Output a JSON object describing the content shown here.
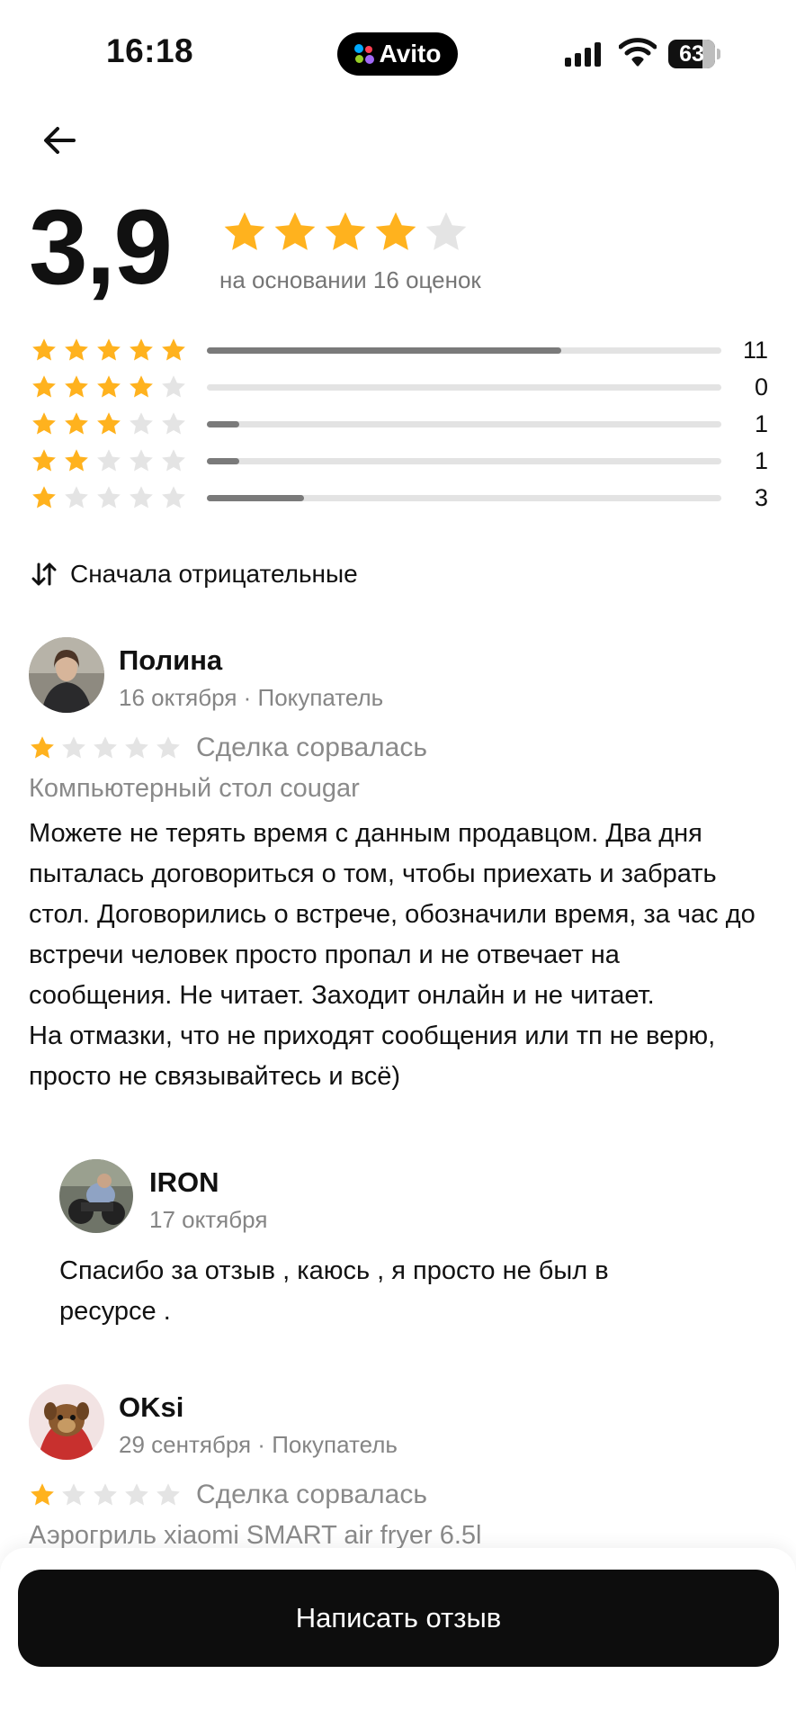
{
  "status_bar": {
    "time": "16:18",
    "app_badge": "Avito",
    "battery": "63"
  },
  "summary": {
    "rating": "3,9",
    "rating_stars": 4,
    "based_on": "на основании 16 оценок",
    "distribution": [
      {
        "stars": 5,
        "count": "11",
        "fraction": 0.688
      },
      {
        "stars": 4,
        "count": "0",
        "fraction": 0.0
      },
      {
        "stars": 3,
        "count": "1",
        "fraction": 0.063
      },
      {
        "stars": 2,
        "count": "1",
        "fraction": 0.063
      },
      {
        "stars": 1,
        "count": "3",
        "fraction": 0.188
      }
    ]
  },
  "sort": {
    "label": "Сначала отрицательные"
  },
  "reviews": [
    {
      "name": "Полина",
      "meta": "16 октября · Покупатель",
      "stars": 1,
      "status": "Сделка сорвалась",
      "item": "Компьютерный стол cougar",
      "text": "Можете не терять время с данным продавцом. Два дня пыталась договориться о том, чтобы приехать и забрать стол. Договорились о встрече, обозначили время, за час до встречи человек просто пропал и не отвечает на сообщения. Не читает. Заходит онлайн и не читает.\nНа отмазки, что не приходят сообщения или тп не верю, просто не связывайтесь и всё)",
      "reply": {
        "name": "IRON",
        "date": "17 октября",
        "text": "Спасибо за отзыв , каюсь , я просто не был в ресурсе ."
      }
    },
    {
      "name": "OKsi",
      "meta": "29 сентября · Покупатель",
      "stars": 1,
      "status": "Сделка сорвалась",
      "item": "Аэрогриль xiaomi SMART air fryer 6.5l"
    }
  ],
  "cta": {
    "label": "Написать отзыв"
  },
  "colors": {
    "star_active": "#FFB21E",
    "star_inactive": "#E4E4E4",
    "bar_fill": "#7A7A7A",
    "bar_track": "#E3E3E3",
    "cta_bg": "#0D0D0D"
  },
  "icons": [
    "back-arrow-icon",
    "star-icon",
    "sort-icon",
    "signal-icon",
    "wifi-icon",
    "battery-icon"
  ]
}
